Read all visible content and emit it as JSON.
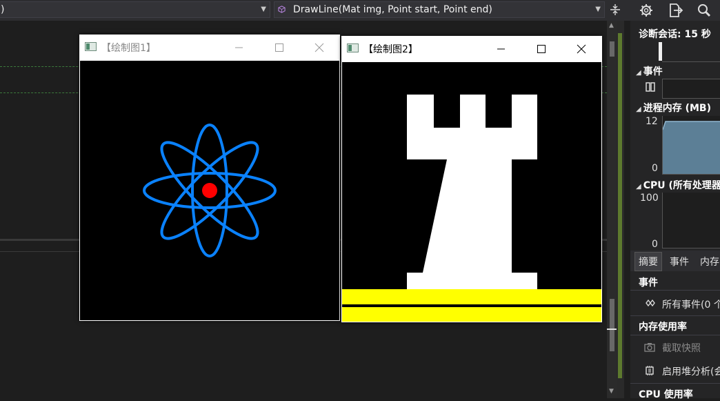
{
  "toolbar": {
    "left_dropdown_text": ")",
    "function_dropdown_text": "DrawLine(Mat img, Point start, Point end)",
    "split_icon": "split-view-icon",
    "settings_icon": "gear-icon",
    "export_icon": "export-icon",
    "zoom_icon": "magnifier-icon"
  },
  "diagnostics": {
    "session_label": "诊断会话: 15 秒",
    "events_header": "事件",
    "memory_header": "进程内存 (MB)",
    "memory_axis_max": "12",
    "memory_axis_min": "0",
    "cpu_header": "CPU (所有处理器",
    "cpu_axis_max": "100",
    "cpu_axis_min": "0",
    "tabs": [
      "摘要",
      "事件",
      "内存"
    ],
    "events_section": "事件",
    "all_events": "所有事件(0 个",
    "memory_usage_section": "内存使用率",
    "take_snapshot": "截取快照",
    "enable_heap": "启用堆分析(会",
    "cpu_usage_section": "CPU 使用率"
  },
  "windows": [
    {
      "title": "【绘制图1】",
      "active": false
    },
    {
      "title": "【绘制图2】",
      "active": true
    }
  ],
  "colors": {
    "atom_orbit": "#0a82ff",
    "atom_core": "#ff0000",
    "rook": "#ffffff",
    "ground": "#ffff00",
    "canvas_bg": "#000000"
  }
}
